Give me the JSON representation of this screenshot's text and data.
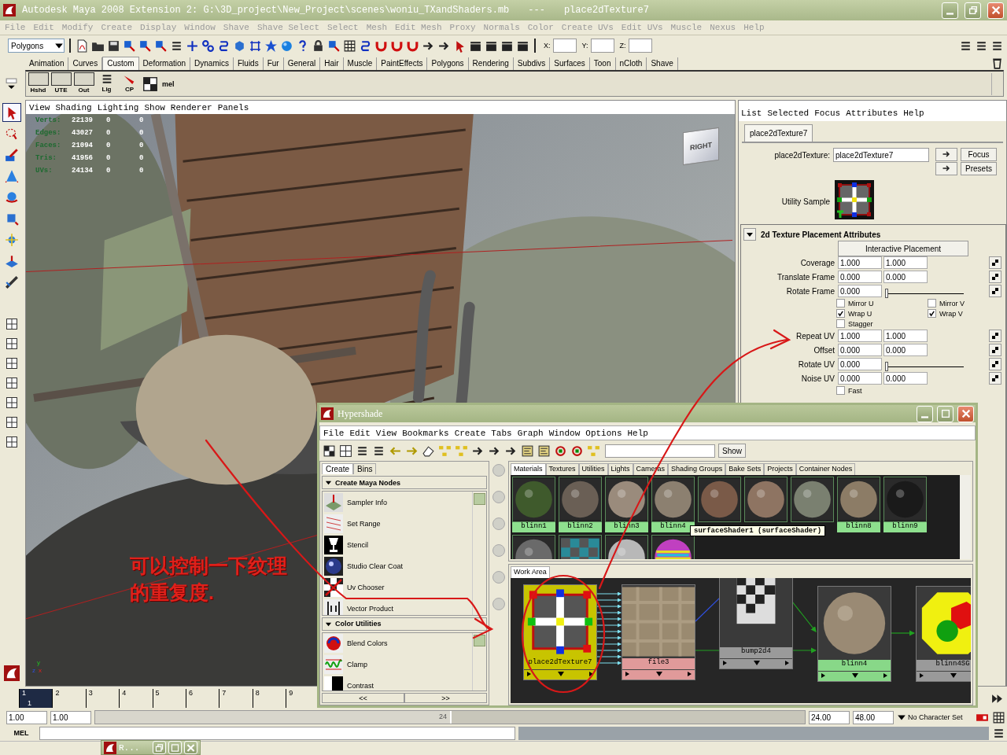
{
  "window": {
    "title": "Autodesk Maya 2008 Extension 2: G:\\3D_project\\New_Project\\scenes\\woniu_TXandShaders.mb",
    "separator": "---",
    "node": "place2dTexture7"
  },
  "menu_bar": [
    "File",
    "Edit",
    "Modify",
    "Create",
    "Display",
    "Window",
    "Shave",
    "Shave Select",
    "Select",
    "Mesh",
    "Edit Mesh",
    "Proxy",
    "Normals",
    "Color",
    "Create UVs",
    "Edit UVs",
    "Muscle",
    "Nexus",
    "Help"
  ],
  "status_line": {
    "mode": "Polygons",
    "x_label": "X:",
    "y_label": "Y:",
    "z_label": "Z:"
  },
  "shelf_tabs": [
    {
      "label": "Animation",
      "selected": false
    },
    {
      "label": "Curves",
      "selected": false
    },
    {
      "label": "Custom",
      "selected": true
    },
    {
      "label": "Deformation",
      "selected": false
    },
    {
      "label": "Dynamics",
      "selected": false
    },
    {
      "label": "Fluids",
      "selected": false
    },
    {
      "label": "Fur",
      "selected": false
    },
    {
      "label": "General",
      "selected": false
    },
    {
      "label": "Hair",
      "selected": false
    },
    {
      "label": "Muscle",
      "selected": false
    },
    {
      "label": "PaintEffects",
      "selected": false
    },
    {
      "label": "Polygons",
      "selected": false
    },
    {
      "label": "Rendering",
      "selected": false
    },
    {
      "label": "Subdivs",
      "selected": false
    },
    {
      "label": "Surfaces",
      "selected": false
    },
    {
      "label": "Toon",
      "selected": false
    },
    {
      "label": "nCloth",
      "selected": false
    },
    {
      "label": "Shave",
      "selected": false
    }
  ],
  "shelf": {
    "buttons": [
      "Hshd",
      "UTE",
      "Out"
    ],
    "icon_buttons": [
      "Lig",
      "CP"
    ],
    "mel": "mel"
  },
  "viewport": {
    "menu": [
      "View",
      "Shading",
      "Lighting",
      "Show",
      "Renderer",
      "Panels"
    ],
    "hud": [
      {
        "label": "Verts:",
        "values": [
          "22139",
          "0",
          "0"
        ]
      },
      {
        "label": "Edges:",
        "values": [
          "43027",
          "0",
          "0"
        ]
      },
      {
        "label": "Faces:",
        "values": [
          "21094",
          "0",
          "0"
        ]
      },
      {
        "label": "Tris:",
        "values": [
          "41956",
          "0",
          "0"
        ]
      },
      {
        "label": "UVs:",
        "values": [
          "24134",
          "0",
          "0"
        ]
      }
    ],
    "view_cube": "RIGHT",
    "axis": [
      "y",
      "z",
      "x"
    ]
  },
  "attribute_editor": {
    "menu": [
      "List",
      "Selected",
      "Focus",
      "Attributes",
      "Help"
    ],
    "tab": "place2dTexture7",
    "node_label": "place2dTexture:",
    "node_name": "place2dTexture7",
    "buttons": [
      "Focus",
      "Presets"
    ],
    "sample_label": "Utility Sample",
    "section": {
      "title": "2d Texture Placement Attributes",
      "expanded": true
    },
    "placement_button": "Interactive Placement",
    "rows": [
      {
        "kind": "pair",
        "label": "Coverage",
        "values": [
          "1.000",
          "1.000"
        ]
      },
      {
        "kind": "pair",
        "label": "Translate Frame",
        "values": [
          "0.000",
          "0.000"
        ]
      },
      {
        "kind": "slider",
        "label": "Rotate Frame",
        "values": [
          "0.000"
        ],
        "level": 0
      },
      {
        "kind": "checks",
        "items": [
          {
            "label": "Mirror U",
            "checked": false
          },
          {
            "label": "Mirror V",
            "checked": false
          }
        ]
      },
      {
        "kind": "checks",
        "items": [
          {
            "label": "Wrap U",
            "checked": true
          },
          {
            "label": "Wrap V",
            "checked": true
          }
        ]
      },
      {
        "kind": "checks",
        "items": [
          {
            "label": "Stagger",
            "checked": false
          }
        ]
      },
      {
        "kind": "pair",
        "label": "Repeat UV",
        "values": [
          "1.000",
          "1.000"
        ]
      },
      {
        "kind": "pair",
        "label": "Offset",
        "values": [
          "0.000",
          "0.000"
        ]
      },
      {
        "kind": "slider",
        "label": "Rotate UV",
        "values": [
          "0.000"
        ],
        "level": 0
      },
      {
        "kind": "pair",
        "label": "Noise UV",
        "values": [
          "0.000",
          "0.000"
        ]
      },
      {
        "kind": "checks",
        "items": [
          {
            "label": "Fast",
            "checked": false
          }
        ]
      }
    ]
  },
  "time_slider": {
    "ticks": [
      {
        "label": "1",
        "selected": true
      },
      {
        "label": "2",
        "selected": false
      },
      {
        "label": "3",
        "selected": false
      },
      {
        "label": "4",
        "selected": false
      },
      {
        "label": "5",
        "selected": false
      },
      {
        "label": "6",
        "selected": false
      },
      {
        "label": "7",
        "selected": false
      },
      {
        "label": "8",
        "selected": false
      },
      {
        "label": "9",
        "selected": false
      }
    ],
    "current": "1"
  },
  "range_slider": {
    "start": "1.00",
    "playback_start": "1.00",
    "range_end": "24",
    "level": 0.5,
    "playback_end": "24.00",
    "end": "48.00",
    "character_set": "No Character Set"
  },
  "command_line": {
    "label": "MEL"
  },
  "minimized_window": {
    "title": "R..."
  },
  "hypershade": {
    "title": "Hypershade",
    "menu": [
      "File",
      "Edit",
      "View",
      "Bookmarks",
      "Create",
      "Tabs",
      "Graph",
      "Window",
      "Options",
      "Help"
    ],
    "show_button": "Show",
    "create_tabs": [
      {
        "label": "Create",
        "selected": true
      },
      {
        "label": "Bins",
        "selected": false
      }
    ],
    "groups": [
      {
        "title": "Create Maya Nodes",
        "expanded": true,
        "items": [
          "Sampler Info",
          "Set Range",
          "Stencil",
          "Studio Clear Coat",
          "Uv Chooser",
          "Vector Product"
        ]
      },
      {
        "title": "Color Utilities",
        "expanded": true,
        "items": [
          "Blend Colors",
          "Clamp",
          "Contrast"
        ]
      }
    ],
    "nav": [
      "<<",
      ">>"
    ],
    "bin_tabs": [
      {
        "label": "Materials",
        "selected": true
      },
      {
        "label": "Textures",
        "selected": false
      },
      {
        "label": "Utilities",
        "selected": false
      },
      {
        "label": "Lights",
        "selected": false
      },
      {
        "label": "Cameras",
        "selected": false
      },
      {
        "label": "Shading Groups",
        "selected": false
      },
      {
        "label": "Bake Sets",
        "selected": false
      },
      {
        "label": "Projects",
        "selected": false
      },
      {
        "label": "Container Nodes",
        "selected": false
      }
    ],
    "swatches": [
      {
        "kind": "sphere",
        "label": "blinn1",
        "color": "#3f5a2c"
      },
      {
        "kind": "sphere",
        "label": "blinn2",
        "color": "#6a5f55"
      },
      {
        "kind": "sphere",
        "label": "blinn3",
        "color": "#9a8b7c"
      },
      {
        "kind": "sphere",
        "label": "blinn4",
        "color": "#8c8070"
      },
      {
        "kind": "sphere",
        "color": "#7a5a48"
      },
      {
        "kind": "sphere",
        "color": "#8e7462"
      },
      {
        "kind": "sphere",
        "color": "#7a8070"
      },
      {
        "kind": "sphere",
        "label": "blinn8",
        "color": "#8c7c66"
      },
      {
        "kind": "sphere",
        "label": "blinn9",
        "color": "#1a1a1a"
      },
      {
        "kind": "sphere",
        "color": "#6a6a6a"
      },
      {
        "kind": "checker",
        "color": "#2a8a98"
      },
      {
        "kind": "sphere",
        "color": "#b8b8b8"
      },
      {
        "kind": "rainbow",
        "color": "#c040c0"
      }
    ],
    "tooltip": "surfaceShader1 (surfaceShader)",
    "work_area_tab": "Work Area",
    "nodes": [
      {
        "kind": "place2d",
        "label": "place2dTexture7",
        "color": "#c8c400",
        "selected": true
      },
      {
        "kind": "file",
        "label": "file3",
        "color": "#e09a9a",
        "selected": false
      },
      {
        "kind": "bump",
        "label": "bump2d4",
        "color": "#9a9a9a",
        "selected": false
      },
      {
        "kind": "material",
        "label": "blinn4",
        "color": "#88d888",
        "selected": false
      },
      {
        "kind": "shading_group",
        "label": "blinn4SG",
        "color": "#9a9a9a",
        "selected": false
      }
    ]
  },
  "annotation": {
    "text": "可以控制一下纹理的重复度."
  }
}
